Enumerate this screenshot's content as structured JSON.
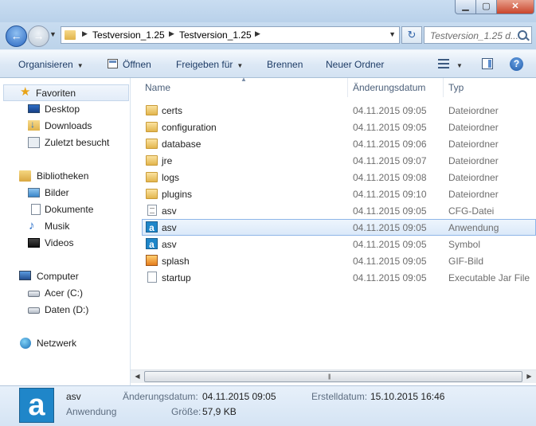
{
  "address": {
    "crumbs": [
      "Testversion_1.25",
      "Testversion_1.25"
    ],
    "search_placeholder": "Testversion_1.25 d..."
  },
  "toolbar": {
    "organize": "Organisieren",
    "open": "Öffnen",
    "share": "Freigeben für",
    "burn": "Brennen",
    "new_folder": "Neuer Ordner"
  },
  "nav": {
    "favorites": "Favoriten",
    "desktop": "Desktop",
    "downloads": "Downloads",
    "recent": "Zuletzt besucht",
    "libraries": "Bibliotheken",
    "pictures": "Bilder",
    "documents": "Dokumente",
    "music": "Musik",
    "videos": "Videos",
    "computer": "Computer",
    "drive_c": "Acer (C:)",
    "drive_d": "Daten (D:)",
    "network": "Netzwerk"
  },
  "columns": {
    "name": "Name",
    "date": "Änderungsdatum",
    "type": "Typ"
  },
  "files": [
    {
      "name": "certs",
      "date": "04.11.2015 09:05",
      "type": "Dateiordner",
      "icon": "folder-icon"
    },
    {
      "name": "configuration",
      "date": "04.11.2015 09:05",
      "type": "Dateiordner",
      "icon": "folder-icon"
    },
    {
      "name": "database",
      "date": "04.11.2015 09:06",
      "type": "Dateiordner",
      "icon": "folder-icon"
    },
    {
      "name": "jre",
      "date": "04.11.2015 09:07",
      "type": "Dateiordner",
      "icon": "folder-icon"
    },
    {
      "name": "logs",
      "date": "04.11.2015 09:08",
      "type": "Dateiordner",
      "icon": "folder-icon"
    },
    {
      "name": "plugins",
      "date": "04.11.2015 09:10",
      "type": "Dateiordner",
      "icon": "folder-icon"
    },
    {
      "name": "asv",
      "date": "04.11.2015 09:05",
      "type": "CFG-Datei",
      "icon": "cfg-file-icon"
    },
    {
      "name": "asv",
      "date": "04.11.2015 09:05",
      "type": "Anwendung",
      "icon": "app-icon"
    },
    {
      "name": "asv",
      "date": "04.11.2015 09:05",
      "type": "Symbol",
      "icon": "app-icon"
    },
    {
      "name": "splash",
      "date": "04.11.2015 09:05",
      "type": "GIF-Bild",
      "icon": "gif-icon"
    },
    {
      "name": "startup",
      "date": "04.11.2015 09:05",
      "type": "Executable Jar File",
      "icon": "jar-icon"
    }
  ],
  "details": {
    "icon_letter": "a",
    "name": "asv",
    "type": "Anwendung",
    "modified_label": "Änderungsdatum:",
    "modified_value": "04.11.2015 09:05",
    "created_label": "Erstelldatum:",
    "created_value": "15.10.2015 16:46",
    "size_label": "Größe:",
    "size_value": "57,9 KB"
  },
  "colors": {
    "selection_border": "#8eb6e8",
    "app_icon": "#1f86c9",
    "link_text": "#1e3c66"
  }
}
